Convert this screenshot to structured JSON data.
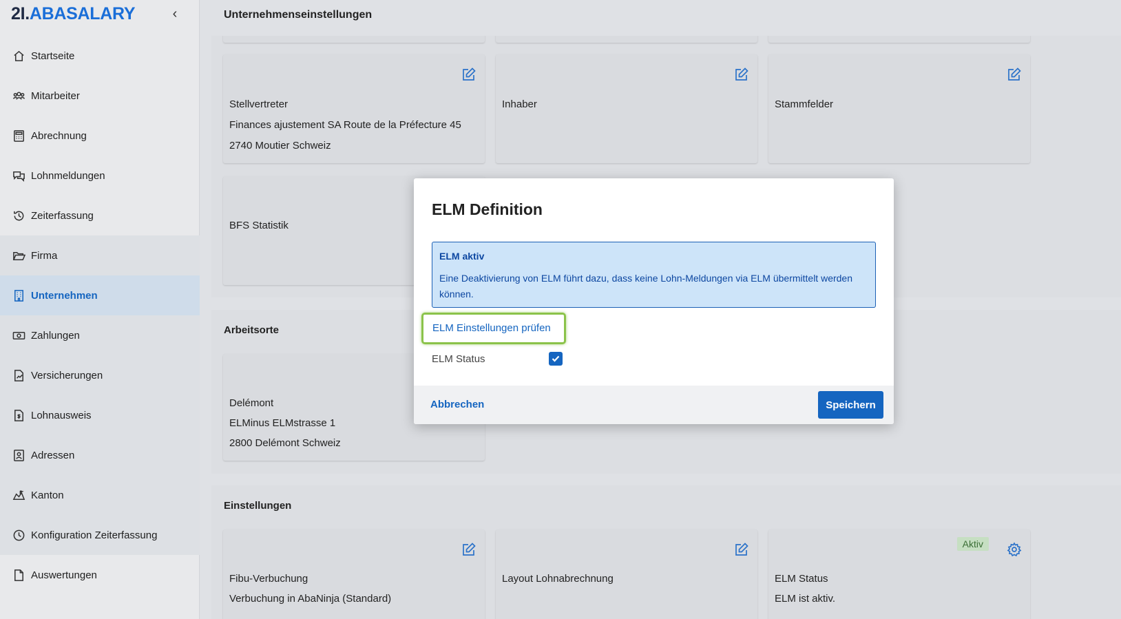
{
  "app": {
    "logo_number": "2I.",
    "logo_brand": "ABASALARY",
    "collapse_glyph": "‹"
  },
  "sidebar": {
    "items": [
      {
        "label": "Startseite",
        "icon": "home-icon"
      },
      {
        "label": "Mitarbeiter",
        "icon": "users-icon"
      },
      {
        "label": "Abrechnung",
        "icon": "calculator-icon"
      },
      {
        "label": "Lohnmeldungen",
        "icon": "messages-icon"
      },
      {
        "label": "Zeiterfassung",
        "icon": "history-icon"
      },
      {
        "label": "Firma",
        "icon": "folder-open-icon"
      },
      {
        "label": "Unternehmen",
        "icon": "building-icon"
      },
      {
        "label": "Zahlungen",
        "icon": "money-icon"
      },
      {
        "label": "Versicherungen",
        "icon": "document-chart-icon"
      },
      {
        "label": "Lohnausweis",
        "icon": "receipt-icon"
      },
      {
        "label": "Adressen",
        "icon": "contact-card-icon"
      },
      {
        "label": "Kanton",
        "icon": "map-icon"
      },
      {
        "label": "Konfiguration Zeiterfassung",
        "icon": "clock-icon"
      },
      {
        "label": "Auswertungen",
        "icon": "file-icon"
      }
    ],
    "active": "Unternehmen"
  },
  "header": {
    "title": "Unternehmenseinstellungen"
  },
  "sections": {
    "top_cards": [
      {
        "title": "Stellvertreter",
        "line2": "Finances ajustement SA  Route de la Préfecture 45",
        "line3": "2740 Moutier  Schweiz"
      },
      {
        "title": "Inhaber"
      },
      {
        "title": "Stammfelder"
      }
    ],
    "bfs_card": {
      "title": "BFS Statistik"
    },
    "arbeitsorte": {
      "title": "Arbeitsorte",
      "card": {
        "title": "Delémont",
        "line2": "ELMinus  ELMstrasse 1",
        "line3": "2800 Delémont  Schweiz"
      }
    },
    "einstellungen": {
      "title": "Einstellungen",
      "cards": [
        {
          "title": "Fibu-Verbuchung",
          "line2": "Verbuchung in AbaNinja (Standard)"
        },
        {
          "title": "Layout Lohnabrechnung"
        },
        {
          "title": "ELM Status",
          "line2": "ELM ist aktiv.",
          "badge": "Aktiv"
        }
      ]
    }
  },
  "modal": {
    "title": "ELM Definition",
    "info_title": "ELM aktiv",
    "info_text": "Eine Deaktivierung von ELM führt dazu, dass keine Lohn-Meldungen via ELM übermittelt werden können.",
    "check_link": "ELM Einstellungen prüfen",
    "status_label": "ELM Status",
    "status_checked": true,
    "cancel_label": "Abbrechen",
    "save_label": "Speichern"
  },
  "colors": {
    "accent": "#1565c0",
    "highlight": "#8bc34a",
    "info_bg": "#cde4f9",
    "badge_bg": "#c6dfc2"
  }
}
